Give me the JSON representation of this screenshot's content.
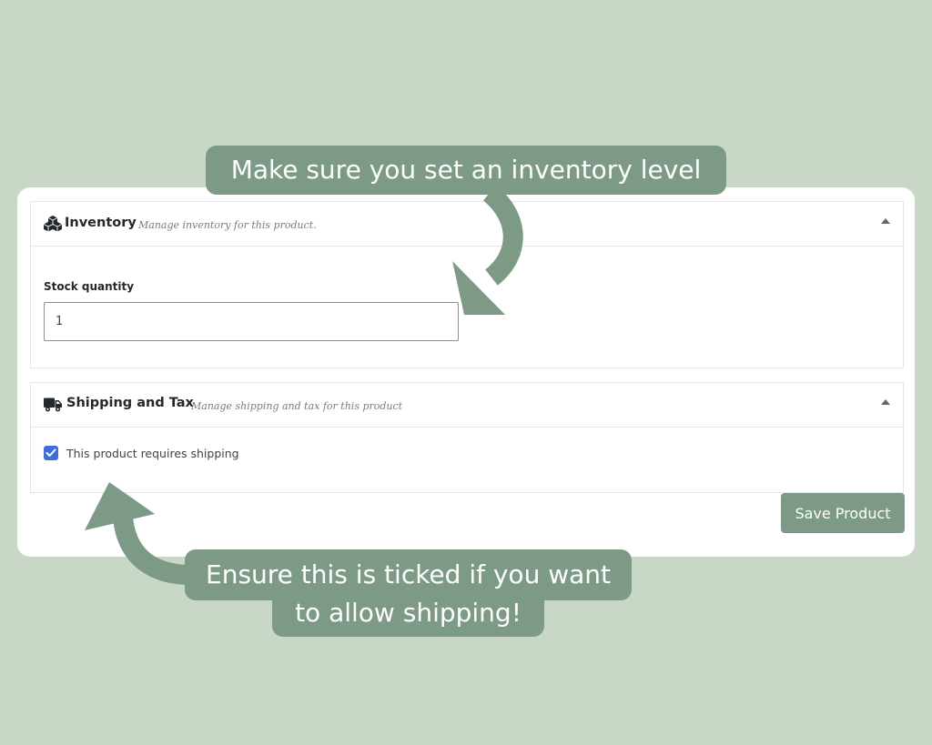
{
  "inventory": {
    "title": "Inventory",
    "subtitle": "Manage inventory for this product.",
    "icon": "cubes-icon",
    "stock_label": "Stock quantity",
    "stock_value": "1"
  },
  "shipping": {
    "title": "Shipping and Tax",
    "subtitle": "Manage shipping and tax for this product",
    "icon": "truck-icon",
    "requires_shipping_label": "This product requires shipping",
    "requires_shipping_checked": true
  },
  "actions": {
    "save_label": "Save Product"
  },
  "callouts": {
    "top": "Make sure you set an inventory level",
    "bottom_line1": "Ensure this is ticked if you want",
    "bottom_line2": "to allow shipping!"
  },
  "colors": {
    "background": "#c8d7c6",
    "accent": "#7d9a86",
    "checkbox": "#3d6edb"
  }
}
